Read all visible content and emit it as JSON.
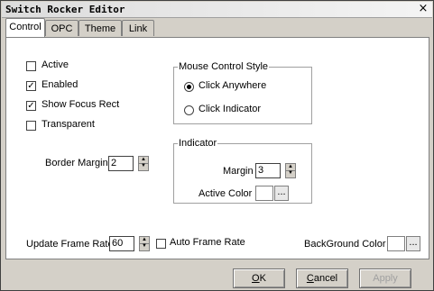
{
  "window": {
    "title": "Switch Rocker Editor",
    "close_glyph": "×"
  },
  "tabs": [
    {
      "label": "Control",
      "active": true
    },
    {
      "label": "OPC",
      "active": false
    },
    {
      "label": "Theme",
      "active": false
    },
    {
      "label": "Link",
      "active": false
    }
  ],
  "checkboxes": {
    "active": {
      "label": "Active",
      "checked": false
    },
    "enabled": {
      "label": "Enabled",
      "checked": true
    },
    "show_focus_rect": {
      "label": "Show Focus Rect",
      "checked": true
    },
    "transparent": {
      "label": "Transparent",
      "checked": false
    },
    "auto_frame_rate": {
      "label": "Auto Frame Rate",
      "checked": false
    }
  },
  "mouse_control_style": {
    "label": "Mouse Control Style",
    "click_anywhere": {
      "label": "Click Anywhere",
      "selected": true
    },
    "click_indicator": {
      "label": "Click Indicator",
      "selected": false
    }
  },
  "indicator": {
    "label": "Indicator",
    "margin_label": "Margin",
    "margin_value": "3",
    "active_color_label": "Active Color",
    "active_color": "#ffffff",
    "browse_label": "..."
  },
  "border_margin": {
    "label": "Border Margin",
    "value": "2"
  },
  "update_frame_rate": {
    "label": "Update Frame Rate",
    "value": "60"
  },
  "background_color": {
    "label": "BackGround Color",
    "color": "#ffffff",
    "browse_label": "..."
  },
  "buttons": {
    "ok": {
      "accel": "O",
      "rest": "K"
    },
    "cancel": {
      "accel": "C",
      "rest": "ancel"
    },
    "apply": {
      "label": "Apply",
      "enabled": false
    }
  },
  "check_glyph": "✓"
}
